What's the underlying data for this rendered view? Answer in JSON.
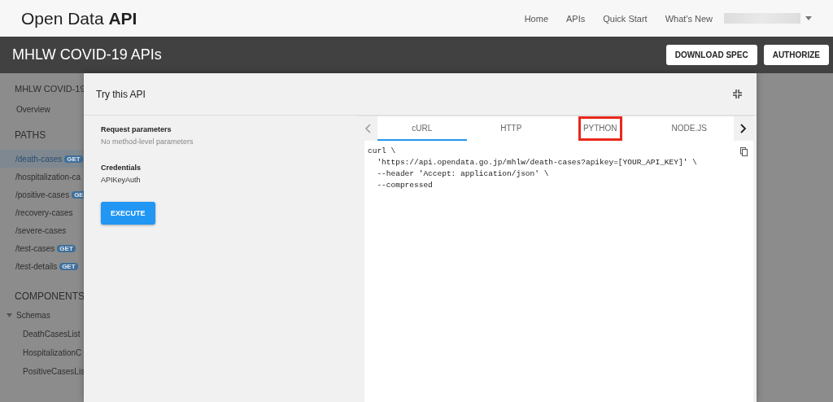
{
  "header": {
    "logo_light": "Open Data",
    "logo_bold": "API",
    "nav": [
      "Home",
      "APIs",
      "Quick Start",
      "What's New"
    ]
  },
  "title_bar": {
    "title": "MHLW COVID-19 APIs",
    "buttons": [
      "DOWNLOAD SPEC",
      "AUTHORIZE"
    ]
  },
  "sidebar": {
    "title": "MHLW COVID-19",
    "overview": "Overview",
    "paths_heading": "PATHS",
    "paths": [
      {
        "label": "/death-cases",
        "badge": "GET",
        "selected": true
      },
      {
        "label": "/hospitalization-ca",
        "selected": false
      },
      {
        "label": "/positive-cases",
        "badge": "GE",
        "selected": false
      },
      {
        "label": "/recovery-cases",
        "selected": false
      },
      {
        "label": "/severe-cases",
        "selected": false
      },
      {
        "label": "/test-cases",
        "badge": "GET",
        "selected": false
      },
      {
        "label": "/test-details",
        "badge": "GET",
        "selected": false
      }
    ],
    "components_heading": "COMPONENTS",
    "schemas": {
      "label": "Schemas",
      "expanded": true,
      "children": [
        "DeathCasesList",
        "HospitalizationC",
        "PositiveCasesLis"
      ]
    }
  },
  "dialog": {
    "title": "Try this API",
    "request_label": "Request parameters",
    "request_value": "No method-level parameters",
    "credentials_label": "Credentials",
    "credentials_value": "APIKeyAuth",
    "execute": "EXECUTE",
    "tabs": [
      {
        "label": "cURL",
        "selected": true,
        "highlighted": false
      },
      {
        "label": "HTTP",
        "selected": false,
        "highlighted": false
      },
      {
        "label": "PYTHON",
        "selected": false,
        "highlighted": true
      },
      {
        "label": "NODE.JS",
        "selected": false,
        "highlighted": false
      }
    ],
    "code": [
      "curl \\",
      "  'https://api.opendata.go.jp/mhlw/death-cases?apikey=[YOUR_API_KEY]' \\",
      "  --header 'Accept: application/json' \\",
      "  --compressed"
    ]
  }
}
